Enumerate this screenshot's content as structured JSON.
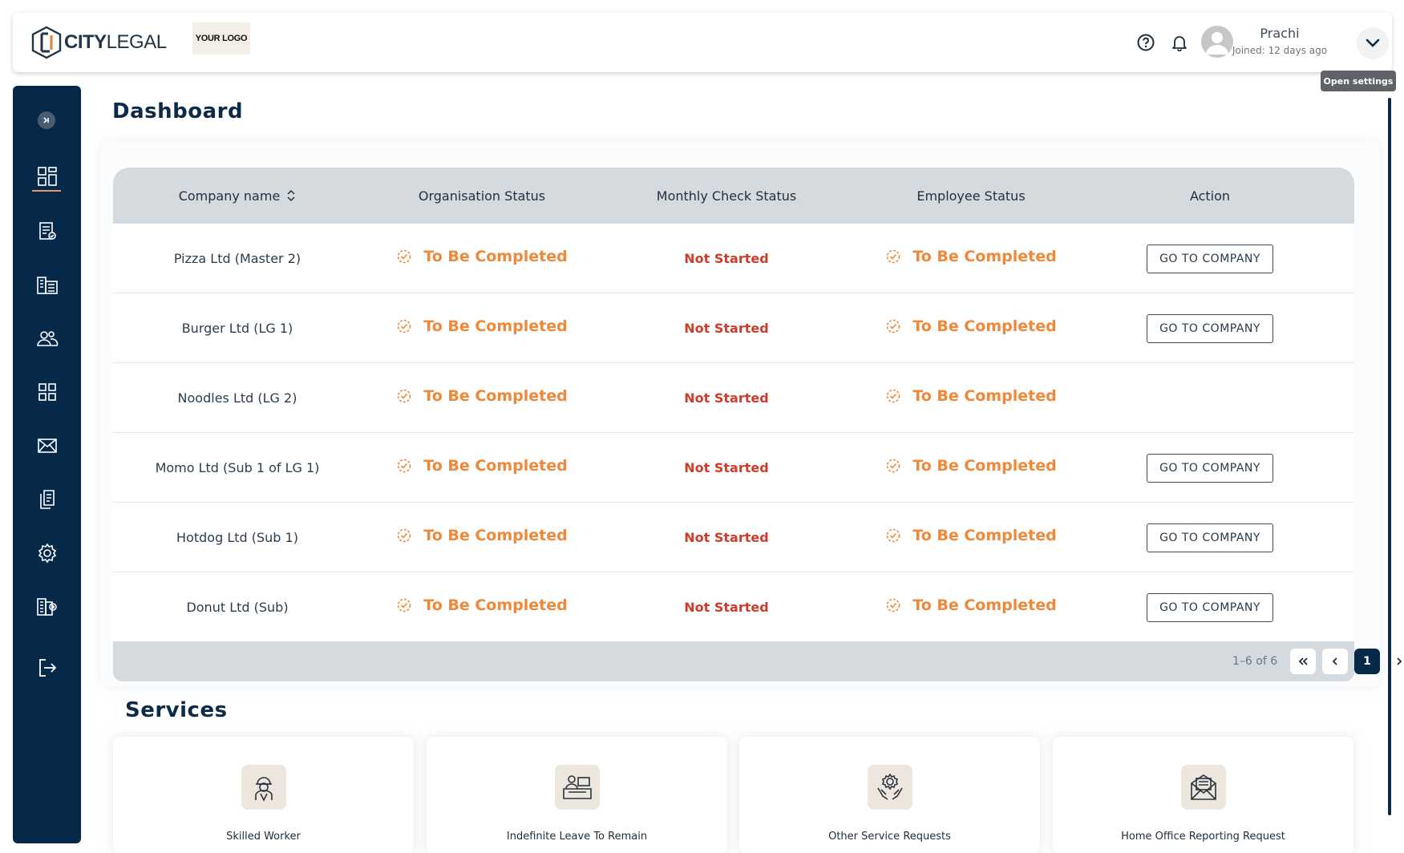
{
  "header": {
    "brand_bold": "CITY",
    "brand_light": "LEGAL",
    "your_logo": "YOUR LOGO",
    "user_name": "Prachi",
    "user_joined": "Joined: 12 days ago",
    "tooltip": "Open settings"
  },
  "sidebar": {
    "items": [
      {
        "icon": "dashboard-icon",
        "active": true
      },
      {
        "icon": "clipboard-check-icon"
      },
      {
        "icon": "buildings-icon"
      },
      {
        "icon": "users-icon"
      },
      {
        "icon": "grid-icon"
      },
      {
        "icon": "mail-icon"
      },
      {
        "icon": "documents-icon"
      },
      {
        "icon": "settings-icon"
      },
      {
        "icon": "building-settings-icon"
      },
      {
        "icon": "logout-icon"
      }
    ]
  },
  "main": {
    "title": "Dashboard",
    "table": {
      "columns": [
        "Company name",
        "Organisation Status",
        "Monthly Check Status",
        "Employee Status",
        "Action"
      ],
      "rows": [
        {
          "company": "Pizza Ltd (Master 2)",
          "org_status": "To Be Completed",
          "monthly_status": "Not Started",
          "employee_status": "To Be Completed",
          "action": "GO TO COMPANY"
        },
        {
          "company": "Burger Ltd (LG 1)",
          "org_status": "To Be Completed",
          "monthly_status": "Not Started",
          "employee_status": "To Be Completed",
          "action": "GO TO COMPANY"
        },
        {
          "company": "Noodles Ltd (LG 2)",
          "org_status": "To Be Completed",
          "monthly_status": "Not Started",
          "employee_status": "To Be Completed",
          "action": ""
        },
        {
          "company": "Momo Ltd (Sub 1 of LG 1)",
          "org_status": "To Be Completed",
          "monthly_status": "Not Started",
          "employee_status": "To Be Completed",
          "action": "GO TO COMPANY"
        },
        {
          "company": "Hotdog Ltd (Sub 1)",
          "org_status": "To Be Completed",
          "monthly_status": "Not Started",
          "employee_status": "To Be Completed",
          "action": "GO TO COMPANY"
        },
        {
          "company": "Donut Ltd (Sub)",
          "org_status": "To Be Completed",
          "monthly_status": "Not Started",
          "employee_status": "To Be Completed",
          "action": "GO TO COMPANY"
        }
      ],
      "pagination": {
        "count": "1–6 of 6",
        "current_page": "1"
      }
    },
    "services": {
      "title": "Services",
      "items": [
        {
          "label": "Skilled Worker",
          "icon": "worker-icon"
        },
        {
          "label": "Indefinite Leave To Remain",
          "icon": "desk-icon"
        },
        {
          "label": "Other Service Requests",
          "icon": "gear-hands-icon"
        },
        {
          "label": "Home Office Reporting Request",
          "icon": "mail-report-icon"
        }
      ]
    }
  },
  "colors": {
    "navy": "#06294a",
    "orange_status": "#f0883a",
    "red_status": "#d13b2a",
    "table_head": "#d5dade"
  }
}
